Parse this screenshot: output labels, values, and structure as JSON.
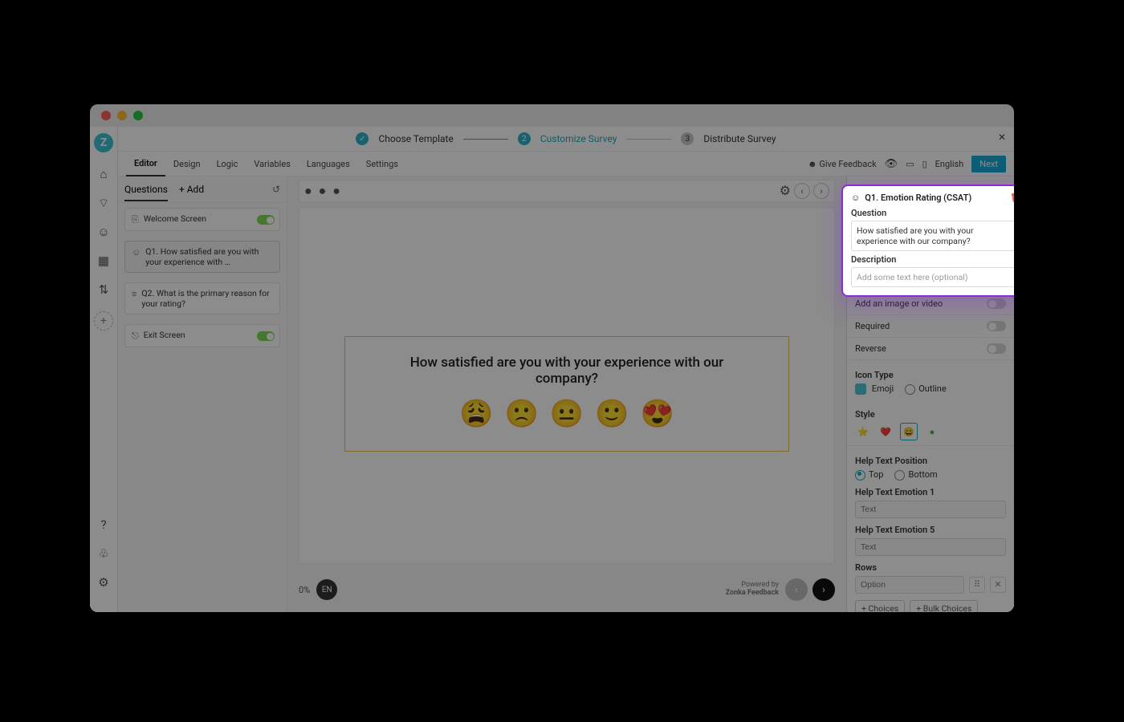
{
  "stepper": {
    "s1": "Choose Template",
    "s2": "Customize Survey",
    "s3": "Distribute Survey",
    "s3num": "3"
  },
  "subnav": {
    "tabs": [
      "Editor",
      "Design",
      "Logic",
      "Variables",
      "Languages",
      "Settings"
    ],
    "give_feedback": "Give Feedback",
    "language": "English",
    "next": "Next"
  },
  "qpanel": {
    "questions": "Questions",
    "add": "+ Add",
    "items": [
      {
        "title": "Welcome Screen",
        "toggle": true
      },
      {
        "title": "Q1. How satisfied are you with your experience with …"
      },
      {
        "title": "Q2. What is the primary reason for your rating?"
      },
      {
        "title": "Exit Screen",
        "toggle": true
      }
    ]
  },
  "canvas": {
    "question": "How satisfied are you with your experience with our company?",
    "emojis": [
      "😩",
      "🙁",
      "😐",
      "🙂",
      "😍"
    ],
    "pct": "0%",
    "lang": "EN",
    "powered_top": "Powered by",
    "powered_bottom": "Zonka Feedback"
  },
  "highlight": {
    "title": "Q1. Emotion Rating (CSAT)",
    "q_label": "Question",
    "q_value": "How satisfied are you with your experience with our company?",
    "d_label": "Description",
    "d_placeholder": "Add some text here (optional)"
  },
  "props": {
    "add_media": "Add an image or video",
    "required": "Required",
    "reverse": "Reverse",
    "icon_type": "Icon Type",
    "icon_emoji": "Emoji",
    "icon_outline": "Outline",
    "style": "Style",
    "help_pos": "Help Text Position",
    "pos_top": "Top",
    "pos_bottom": "Bottom",
    "hte1": "Help Text Emotion 1",
    "hte5": "Help Text Emotion 5",
    "text_ph": "Text",
    "rows": "Rows",
    "option_ph": "Option",
    "add_choices": "+ Choices",
    "bulk_choices": "+ Bulk Choices"
  }
}
